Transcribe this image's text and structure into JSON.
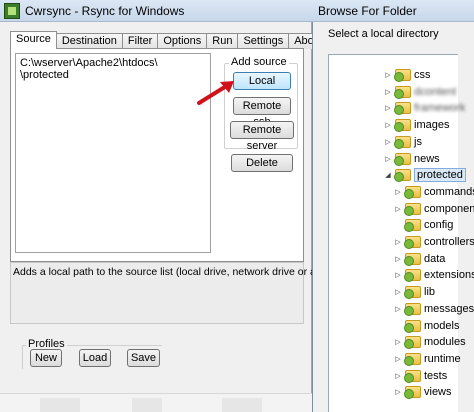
{
  "left_window": {
    "title": "Cwrsync - Rsync for Windows",
    "tabs": [
      "Source",
      "Destination",
      "Filter",
      "Options",
      "Run",
      "Settings",
      "About"
    ],
    "active_tab": "Source",
    "source_list": [
      "C:\\wserver\\Apache2\\htdocs\\    \\protected"
    ],
    "add_source": {
      "label": "Add source",
      "local": "Local",
      "remote_ssh": "Remote ssh",
      "remote_server": "Remote server"
    },
    "delete": "Delete",
    "help_text": "Adds a local path to the source list (local drive, network drive or a UNC path).",
    "profiles": {
      "label": "Profiles",
      "new": "New",
      "load": "Load",
      "save": "Save"
    }
  },
  "right_window": {
    "title": "Browse For Folder",
    "label": "Select a local directory",
    "tree": [
      {
        "label": "css",
        "level": 0,
        "expand": "collapsed"
      },
      {
        "label": "dcontent",
        "level": 0,
        "expand": "collapsed",
        "blurred": true
      },
      {
        "label": "framework",
        "level": 0,
        "expand": "collapsed",
        "blurred": true
      },
      {
        "label": "images",
        "level": 0,
        "expand": "collapsed"
      },
      {
        "label": "js",
        "level": 0,
        "expand": "collapsed"
      },
      {
        "label": "news",
        "level": 0,
        "expand": "collapsed"
      },
      {
        "label": "protected",
        "level": 0,
        "expand": "expanded",
        "selected": true
      },
      {
        "label": "commands",
        "level": 1,
        "expand": "collapsed"
      },
      {
        "label": "components",
        "level": 1,
        "expand": "collapsed"
      },
      {
        "label": "config",
        "level": 1,
        "expand": "none"
      },
      {
        "label": "controllers",
        "level": 1,
        "expand": "collapsed"
      },
      {
        "label": "data",
        "level": 1,
        "expand": "collapsed"
      },
      {
        "label": "extensions",
        "level": 1,
        "expand": "collapsed"
      },
      {
        "label": "lib",
        "level": 1,
        "expand": "collapsed"
      },
      {
        "label": "messages",
        "level": 1,
        "expand": "collapsed"
      },
      {
        "label": "models",
        "level": 1,
        "expand": "none"
      },
      {
        "label": "modules",
        "level": 1,
        "expand": "collapsed"
      },
      {
        "label": "runtime",
        "level": 1,
        "expand": "collapsed"
      },
      {
        "label": "tests",
        "level": 1,
        "expand": "collapsed"
      },
      {
        "label": "views",
        "level": 1,
        "expand": "collapsed"
      }
    ]
  },
  "colors": {
    "selection": "#dbe9f7",
    "arrow": "#d0121b",
    "folder": "#e9bf45",
    "folder_badge": "#79b93a"
  }
}
